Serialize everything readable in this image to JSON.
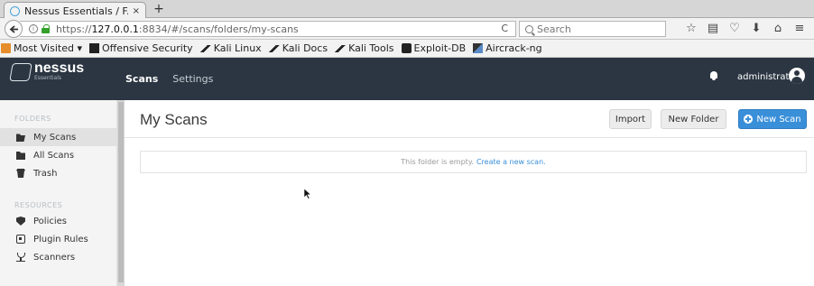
{
  "browser": {
    "tab_title": "Nessus Essentials / F...",
    "tab_close": "×",
    "new_tab": "+",
    "url_prefix": "https://",
    "url_host": "127.0.0.1",
    "url_rest": ":8834/#/scans/folders/my-scans",
    "reload": "C",
    "search_placeholder": "Search",
    "toolbar_icons": [
      "star-icon",
      "reading-list-icon",
      "pocket-icon",
      "download-icon",
      "home-icon",
      "menu-icon"
    ],
    "toolbar_glyphs": [
      "☆",
      "▤",
      "♡",
      "⬇",
      "⌂",
      "≡"
    ]
  },
  "bookmarks": [
    {
      "label": "Most Visited ▾",
      "icon": "folder"
    },
    {
      "label": "Offensive Security",
      "icon": "os"
    },
    {
      "label": "Kali Linux",
      "icon": "kali"
    },
    {
      "label": "Kali Docs",
      "icon": "kali"
    },
    {
      "label": "Kali Tools",
      "icon": "kali"
    },
    {
      "label": "Exploit-DB",
      "icon": "edb"
    },
    {
      "label": "Aircrack-ng",
      "icon": "air"
    }
  ],
  "app": {
    "logo": "nessus",
    "logo_sub": "Essentials",
    "nav": {
      "scans": "Scans",
      "settings": "Settings"
    },
    "user": "administrator",
    "header_bg": "#2b3642",
    "accent": "#3a8fd9"
  },
  "sidebar": {
    "folders_heading": "FOLDERS",
    "resources_heading": "RESOURCES",
    "folders": [
      {
        "label": "My Scans",
        "icon": "folder-open-icon",
        "active": true
      },
      {
        "label": "All Scans",
        "icon": "folder-icon",
        "active": false
      },
      {
        "label": "Trash",
        "icon": "trash-icon",
        "active": false
      }
    ],
    "resources": [
      {
        "label": "Policies",
        "icon": "shield-icon"
      },
      {
        "label": "Plugin Rules",
        "icon": "plugin-icon"
      },
      {
        "label": "Scanners",
        "icon": "scanner-icon"
      }
    ]
  },
  "main": {
    "title": "My Scans",
    "import_label": "Import",
    "new_folder_label": "New Folder",
    "new_scan_label": "New Scan",
    "empty_text": "This folder is empty.",
    "empty_link": "Create a new scan."
  }
}
